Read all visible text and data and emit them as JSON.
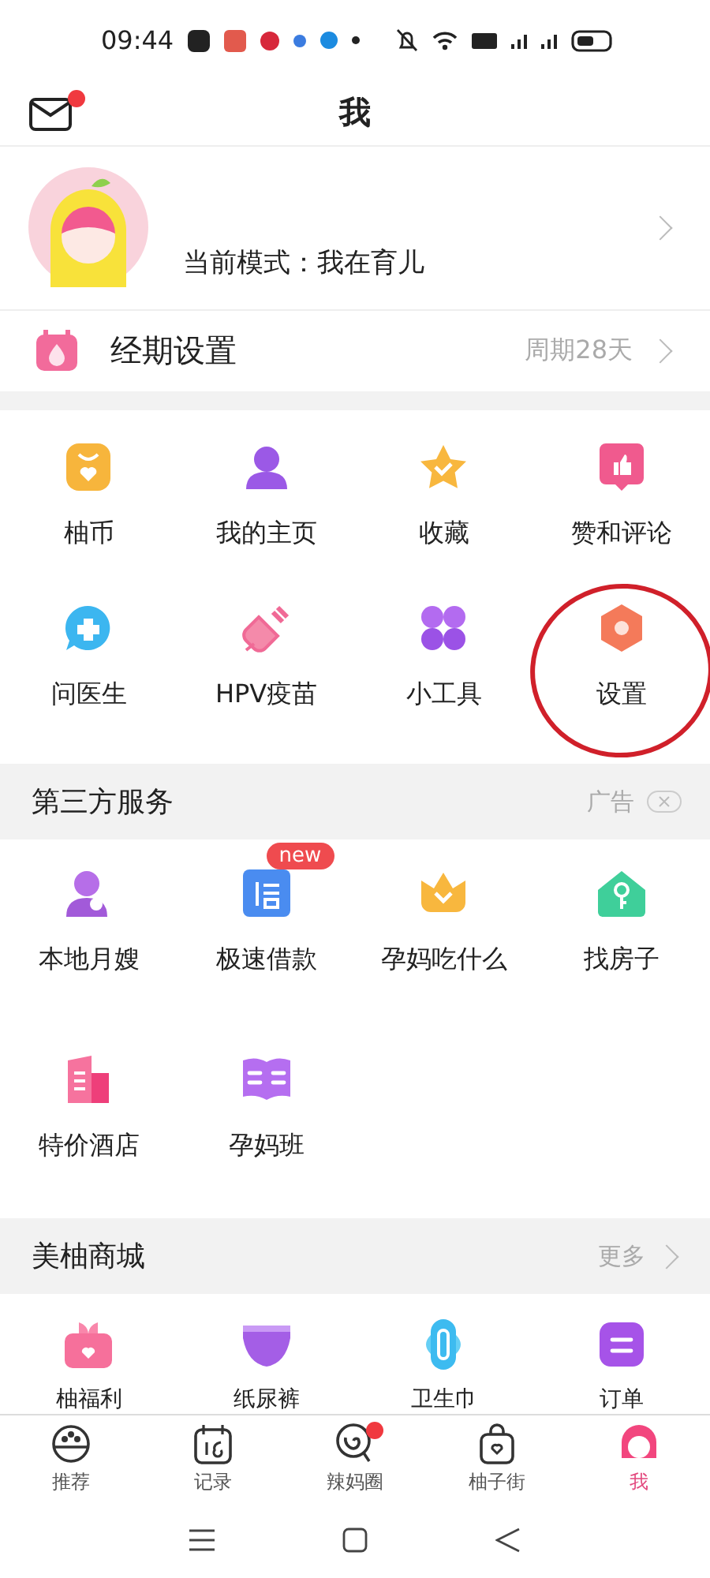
{
  "status_bar": {
    "time": "09:44"
  },
  "header": {
    "title": "我",
    "mail_unread": true
  },
  "profile": {
    "mode_text": "当前模式：我在育儿"
  },
  "period": {
    "label": "经期设置",
    "value": "周期28天"
  },
  "features": [
    {
      "label": "柚币",
      "circled": false
    },
    {
      "label": "我的主页",
      "circled": false
    },
    {
      "label": "收藏",
      "circled": false
    },
    {
      "label": "赞和评论",
      "circled": false
    },
    {
      "label": "问医生",
      "circled": false
    },
    {
      "label": "HPV疫苗",
      "circled": false
    },
    {
      "label": "小工具",
      "circled": false
    },
    {
      "label": "设置",
      "circled": true
    }
  ],
  "third_party": {
    "title": "第三方服务",
    "ad_label": "广告",
    "items": [
      {
        "label": "本地月嫂"
      },
      {
        "label": "极速借款",
        "badge": "new"
      },
      {
        "label": "孕妈吃什么"
      },
      {
        "label": "找房子"
      },
      {
        "label": "特价酒店"
      },
      {
        "label": "孕妈班"
      }
    ]
  },
  "shop": {
    "title": "美柚商城",
    "more": "更多",
    "items": [
      {
        "label": "柚福利"
      },
      {
        "label": "纸尿裤"
      },
      {
        "label": "卫生巾"
      },
      {
        "label": "订单"
      }
    ]
  },
  "tabs": [
    {
      "label": "推荐",
      "selected": false,
      "unread": false
    },
    {
      "label": "记录",
      "selected": false,
      "unread": false
    },
    {
      "label": "辣妈圈",
      "selected": false,
      "unread": true
    },
    {
      "label": "柚子街",
      "selected": false,
      "unread": false
    },
    {
      "label": "我",
      "selected": true,
      "unread": false
    }
  ]
}
